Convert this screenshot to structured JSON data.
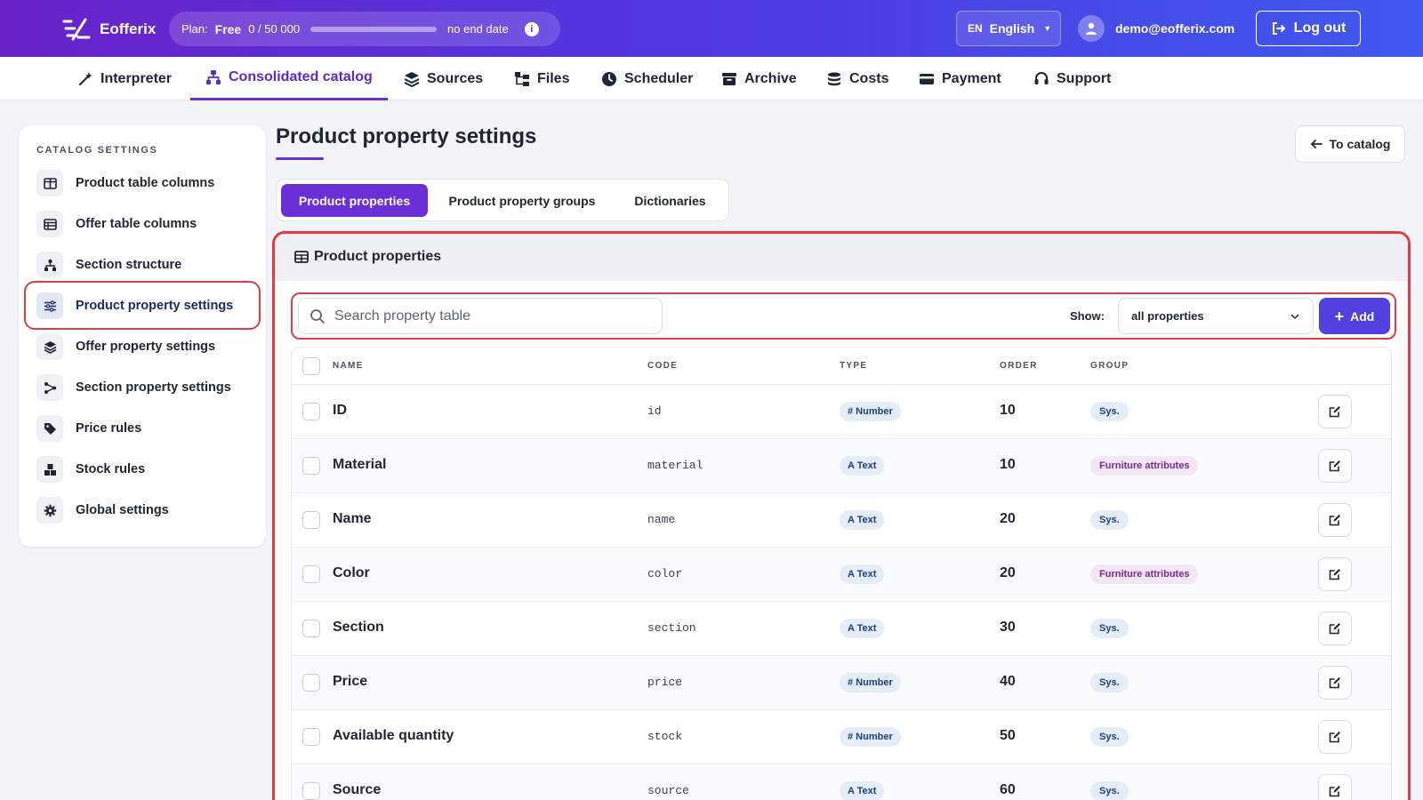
{
  "app": {
    "name": "Eofferix",
    "plan_label": "Plan:",
    "plan_name": "Free",
    "usage_text": "0  /  50 000",
    "usage_fraction": 0,
    "plan_end": "no end date",
    "lang_code": "EN",
    "lang_name": "English",
    "user_email": "demo@eofferix.com",
    "logout_label": "Log out"
  },
  "nav": {
    "items": [
      {
        "label": "Interpreter",
        "icon": "magic-wand-icon"
      },
      {
        "label": "Consolidated catalog",
        "icon": "sitemap-icon",
        "active": true
      },
      {
        "label": "Sources",
        "icon": "layers-icon"
      },
      {
        "label": "Files",
        "icon": "folder-tree-icon"
      },
      {
        "label": "Scheduler",
        "icon": "clock-icon"
      },
      {
        "label": "Archive",
        "icon": "archive-icon"
      },
      {
        "label": "Costs",
        "icon": "coins-icon"
      },
      {
        "label": "Payment",
        "icon": "credit-card-icon"
      },
      {
        "label": "Support",
        "icon": "headset-icon"
      }
    ]
  },
  "sidebar": {
    "title": "CATALOG SETTINGS",
    "items": [
      {
        "label": "Product table columns",
        "icon": "columns-icon"
      },
      {
        "label": "Offer table columns",
        "icon": "table-icon"
      },
      {
        "label": "Section structure",
        "icon": "hierarchy-icon"
      },
      {
        "label": "Product property settings",
        "icon": "sliders-icon",
        "active": true
      },
      {
        "label": "Offer property settings",
        "icon": "layers-icon"
      },
      {
        "label": "Section property settings",
        "icon": "share-nodes-icon"
      },
      {
        "label": "Price rules",
        "icon": "tags-icon"
      },
      {
        "label": "Stock rules",
        "icon": "boxes-icon"
      },
      {
        "label": "Global settings",
        "icon": "gear-icon"
      }
    ]
  },
  "main": {
    "title": "Product property settings",
    "to_catalog_label": "To catalog",
    "tabs": [
      {
        "label": "Product properties",
        "active": true
      },
      {
        "label": "Product property groups"
      },
      {
        "label": "Dictionaries"
      }
    ],
    "panel_title": "Product properties",
    "search_placeholder": "Search property table",
    "show_label": "Show:",
    "show_value": "all properties",
    "add_label": "Add",
    "columns": [
      "NAME",
      "CODE",
      "TYPE",
      "ORDER",
      "GROUP"
    ],
    "rows": [
      {
        "name": "ID",
        "code": "id",
        "type": "# Number",
        "order": "10",
        "group": "Sys."
      },
      {
        "name": "Material",
        "code": "material",
        "type": "A Text",
        "order": "10",
        "group": "Furniture attributes"
      },
      {
        "name": "Name",
        "code": "name",
        "type": "A Text",
        "order": "20",
        "group": "Sys."
      },
      {
        "name": "Color",
        "code": "color",
        "type": "A Text",
        "order": "20",
        "group": "Furniture attributes"
      },
      {
        "name": "Section",
        "code": "section",
        "type": "A Text",
        "order": "30",
        "group": "Sys."
      },
      {
        "name": "Price",
        "code": "price",
        "type": "# Number",
        "order": "40",
        "group": "Sys."
      },
      {
        "name": "Available quantity",
        "code": "stock",
        "type": "# Number",
        "order": "50",
        "group": "Sys."
      },
      {
        "name": "Source",
        "code": "source",
        "type": "A Text",
        "order": "60",
        "group": "Sys."
      }
    ]
  }
}
